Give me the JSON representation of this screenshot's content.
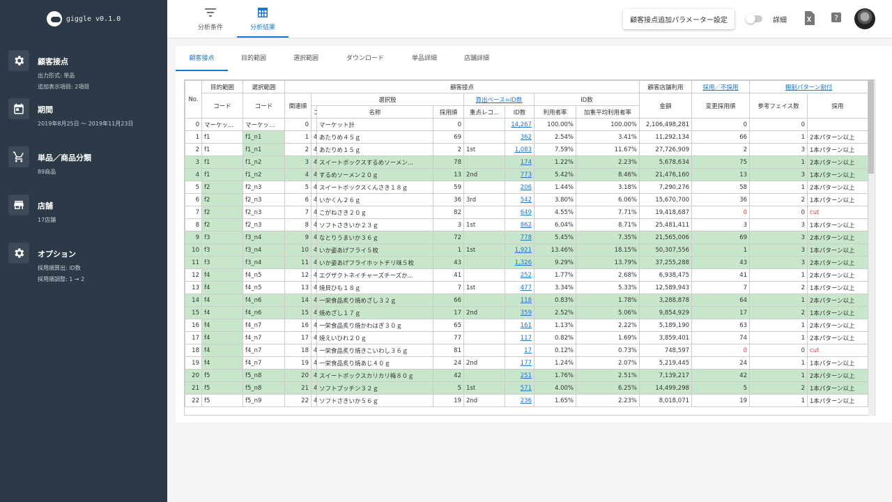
{
  "app": {
    "name": "giggle v0.1.0"
  },
  "sidebar": [
    {
      "title": "顧客接点",
      "icon": "gear-icon",
      "subs": [
        "出力形式: 単品",
        "追加表示項目: 2項目"
      ]
    },
    {
      "title": "期間",
      "icon": "calendar-icon",
      "subs": [
        "2019年8月25日 〜 2019年11月23日"
      ]
    },
    {
      "title": "単品／商品分類",
      "icon": "cart-icon",
      "subs": [
        "89商品"
      ]
    },
    {
      "title": "店舗",
      "icon": "store-icon",
      "subs": [
        "17店舗"
      ]
    },
    {
      "title": "オプション",
      "icon": "gear-icon",
      "subs": [
        "採用順算出: ID数",
        "採用順調整: 1 → 2"
      ]
    }
  ],
  "topbar": {
    "tabs": [
      {
        "label": "分析条件",
        "icon": "filter-icon",
        "active": false
      },
      {
        "label": "分析結果",
        "icon": "table-icon",
        "active": true
      }
    ],
    "param_button": "顧客接点追加パラメーター設定",
    "toggle_label": "詳細",
    "toggle_on": false,
    "icons": [
      "excel-icon",
      "help-icon"
    ]
  },
  "subtabs": [
    {
      "label": "顧客接点",
      "active": true
    },
    {
      "label": "目的範囲"
    },
    {
      "label": "選択範囲"
    },
    {
      "label": "ダウンロード"
    },
    {
      "label": "単品詳細"
    },
    {
      "label": "店舗詳細"
    }
  ],
  "table": {
    "head": {
      "no": "No.",
      "purpose": "目的範囲",
      "selection": "選択範囲",
      "touchpoint": "顧客接点",
      "store_use": "顧客店舗利用",
      "adopt": "採用／不採用",
      "split": "棚割パターン割付",
      "code": "コード",
      "code2": "コード",
      "related": "関連順",
      "choice": "選択肢",
      "calc_base": "算出ベース=ID数",
      "id_count": "ID数",
      "c_col": "コ",
      "name": "名称",
      "adopt_order": "採用順",
      "focus": "重点レコ...",
      "ids": "ID数",
      "usage": "利用者率",
      "weighted": "加重平均利用者率",
      "amount": "金額",
      "changed": "変更採用順",
      "faces": "参考フェイス数",
      "adoption": "採用"
    },
    "rows": [
      [
        "0",
        "マーケッ...",
        "マーケッ...",
        "0",
        "",
        "マーケット計",
        "0",
        "",
        "14,267",
        "100.00%",
        "100.00%",
        "2,106,498,281",
        "0",
        "0",
        ""
      ],
      [
        "1",
        "f1",
        "f1_n1",
        "1",
        "4.",
        "あたりめ４５ｇ",
        "69",
        "",
        "362",
        "2.54%",
        "3.41%",
        "11,292,134",
        "66",
        "1",
        "2本パターン以上"
      ],
      [
        "2",
        "f1",
        "f1_n1",
        "2",
        "4.",
        "あたりめ１５ｇ",
        "2",
        "1st",
        "1,083",
        "7.59%",
        "11.67%",
        "27,726,909",
        "2",
        "3",
        "1本パターン以上"
      ],
      [
        "3",
        "f1",
        "f1_n2",
        "3",
        "4.",
        "スイートボックスするめソーメン...",
        "78",
        "",
        "174",
        "1.22%",
        "2.23%",
        "5,678,634",
        "75",
        "1",
        "2本パターン以上"
      ],
      [
        "4",
        "f1",
        "f1_n2",
        "4",
        "4.",
        "するめソーメン２０ｇ",
        "13",
        "2nd",
        "773",
        "5.42%",
        "8.46%",
        "21,476,160",
        "13",
        "3",
        "1本パターン以上"
      ],
      [
        "5",
        "f2",
        "f2_n3",
        "5",
        "4.",
        "スイートボックスくんさき１８ｇ",
        "59",
        "",
        "206",
        "1.44%",
        "3.18%",
        "7,290,276",
        "58",
        "1",
        "2本パターン以上"
      ],
      [
        "6",
        "f2",
        "f2_n3",
        "6",
        "4.",
        "いかくん２６ｇ",
        "36",
        "3rd",
        "542",
        "3.80%",
        "6.06%",
        "15,670,700",
        "36",
        "2",
        "1本パターン以上"
      ],
      [
        "7",
        "f2",
        "f2_n3",
        "7",
        "4.",
        "こがねさき２０ｇ",
        "82",
        "",
        "649",
        "4.55%",
        "7.71%",
        "19,418,687",
        "0",
        "0",
        "cut"
      ],
      [
        "8",
        "f2",
        "f2_n3",
        "8",
        "4.",
        "ソフトさきいか２３ｇ",
        "3",
        "1st",
        "862",
        "6.04%",
        "8.71%",
        "25,481,411",
        "3",
        "3",
        "1本パターン以上"
      ],
      [
        "9",
        "f3",
        "f3_n4",
        "9",
        "4.",
        "なとりうまいか３６ｇ",
        "72",
        "",
        "778",
        "5.45%",
        "7.35%",
        "21,565,006",
        "69",
        "3",
        "2本パターン以上"
      ],
      [
        "10",
        "f3",
        "f3_n4",
        "10",
        "4.",
        "いか姿あげフライ５枚",
        "1",
        "1st",
        "1,921",
        "13.46%",
        "18.15%",
        "50,307,556",
        "1",
        "3",
        "1本パターン以上"
      ],
      [
        "11",
        "f3",
        "f3_n4",
        "11",
        "4.",
        "いか姿あげフライホットチリ味５枚",
        "43",
        "",
        "1,326",
        "9.29%",
        "13.79%",
        "37,255,288",
        "43",
        "3",
        "2本パターン以上"
      ],
      [
        "12",
        "f4",
        "f4_n5",
        "12",
        "4.",
        "エグザクトネイチャーズチーズか...",
        "41",
        "",
        "252",
        "1.77%",
        "2.68%",
        "6,938,475",
        "41",
        "1",
        "2本パターン以上"
      ],
      [
        "13",
        "f4",
        "f4_n5",
        "13",
        "4.",
        "焼貝ひも１８ｇ",
        "7",
        "1st",
        "477",
        "3.34%",
        "5.33%",
        "12,589,943",
        "7",
        "2",
        "1本パターン以上"
      ],
      [
        "14",
        "f4",
        "f4_n6",
        "14",
        "4.",
        "一栄食品炙り焼めざし３２ｇ",
        "66",
        "",
        "118",
        "0.83%",
        "1.78%",
        "3,288,878",
        "64",
        "1",
        "2本パターン以上"
      ],
      [
        "15",
        "f4",
        "f4_n6",
        "15",
        "4.",
        "焼めざし１７ｇ",
        "17",
        "2nd",
        "359",
        "2.52%",
        "5.06%",
        "9,854,929",
        "17",
        "2",
        "1本パターン以上"
      ],
      [
        "16",
        "f4",
        "f4_n7",
        "16",
        "4.",
        "一栄食品炙り焼かわはぎ３０ｇ",
        "65",
        "",
        "161",
        "1.13%",
        "2.22%",
        "5,189,190",
        "63",
        "1",
        "2本パターン以上"
      ],
      [
        "17",
        "f4",
        "f4_n7",
        "17",
        "4.",
        "焼えいひれ２０ｇ",
        "77",
        "",
        "117",
        "0.82%",
        "1.69%",
        "3,859,401",
        "74",
        "1",
        "2本パターン以上"
      ],
      [
        "18",
        "f4",
        "f4_n7",
        "18",
        "4.",
        "一栄食品炙り焼きこいわし３６ｇ",
        "81",
        "",
        "17",
        "0.12%",
        "0.73%",
        "748,597",
        "0",
        "0",
        "cut"
      ],
      [
        "19",
        "f4",
        "f4_n7",
        "19",
        "4.",
        "一栄食品炙り焼あじ４０ｇ",
        "24",
        "2nd",
        "177",
        "1.24%",
        "2.07%",
        "5,219,445",
        "24",
        "1",
        "1本パターン以上"
      ],
      [
        "20",
        "f5",
        "f5_n8",
        "20",
        "4.",
        "スイートボックスカリカリ梅８０ｇ",
        "42",
        "",
        "251",
        "1.76%",
        "2.51%",
        "7,139,217",
        "42",
        "1",
        "2本パターン以上"
      ],
      [
        "21",
        "f5",
        "f5_n8",
        "21",
        "4.",
        "ソフトプッチン３２ｇ",
        "5",
        "1st",
        "571",
        "4.00%",
        "6.25%",
        "14,499,298",
        "5",
        "2",
        "1本パターン以上"
      ],
      [
        "22",
        "f5",
        "f5_n9",
        "22",
        "4.",
        "ソフトさきいか５６ｇ",
        "19",
        "2nd",
        "236",
        "1.65%",
        "2.23%",
        "8,018,071",
        "19",
        "1",
        "1本パターン以上"
      ]
    ],
    "green_rows": [
      3,
      4,
      9,
      10,
      11,
      14,
      15,
      20,
      21
    ],
    "green_purpose": [
      5,
      6,
      7,
      8,
      12,
      13,
      16,
      17,
      18,
      19
    ],
    "green_selection": [
      1,
      2,
      3,
      4,
      9,
      10,
      11,
      14,
      15,
      20,
      21
    ]
  }
}
